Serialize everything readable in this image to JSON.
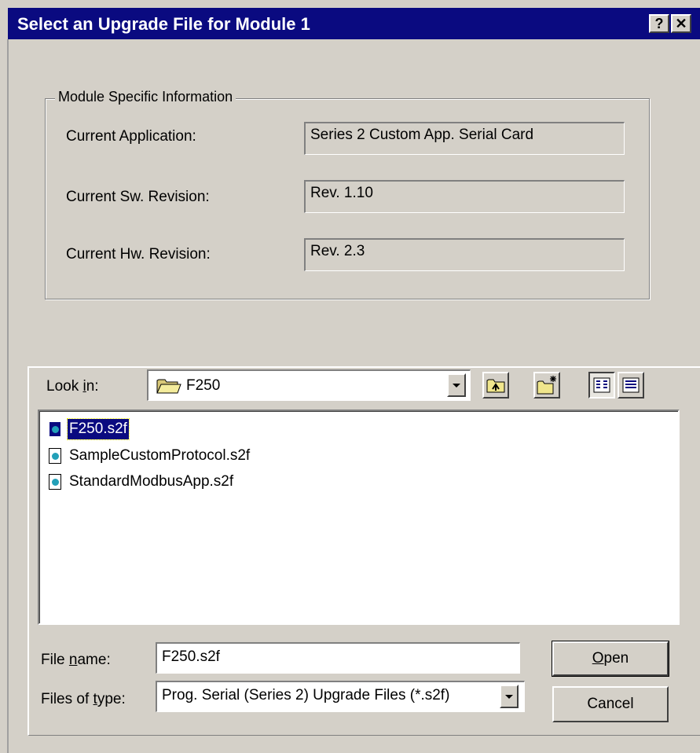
{
  "window": {
    "title": "Select an Upgrade File for Module 1",
    "help_button": "?",
    "close_button": "✕"
  },
  "module_info": {
    "legend": "Module Specific Information",
    "current_application_label": "Current Application:",
    "current_application_value": "Series 2 Custom App. Serial Card",
    "current_sw_label": "Current Sw. Revision:",
    "current_sw_value": "Rev. 1.10",
    "current_hw_label": "Current Hw. Revision:",
    "current_hw_value": "Rev. 2.3"
  },
  "file_dialog": {
    "look_in_label_pre": "Look ",
    "look_in_label_key": "i",
    "look_in_label_post": "n:",
    "look_in_value": "F250",
    "files": [
      {
        "name": "F250.s2f",
        "selected": true
      },
      {
        "name": "SampleCustomProtocol.s2f",
        "selected": false
      },
      {
        "name": "StandardModbusApp.s2f",
        "selected": false
      }
    ],
    "file_name_label_pre": "File ",
    "file_name_label_key": "n",
    "file_name_label_post": "ame:",
    "file_name_value": "F250.s2f",
    "files_of_type_label_pre": "Files of ",
    "files_of_type_label_key": "t",
    "files_of_type_label_post": "ype:",
    "files_of_type_value": "Prog. Serial (Series 2) Upgrade Files (*.s2f)",
    "open_key": "O",
    "open_rest": "pen",
    "cancel_label": "Cancel"
  },
  "icons": {
    "folder": "folder-icon",
    "up_folder": "up-folder-icon",
    "new_folder": "new-folder-icon",
    "list_view": "list-view-icon",
    "details_view": "details-view-icon",
    "file": "s2f-file-icon"
  },
  "colors": {
    "title_bar": "#0a0a80",
    "face": "#d4d0c8",
    "selection": "#0a0a80",
    "file_icon_accent": "#23a0b8"
  }
}
